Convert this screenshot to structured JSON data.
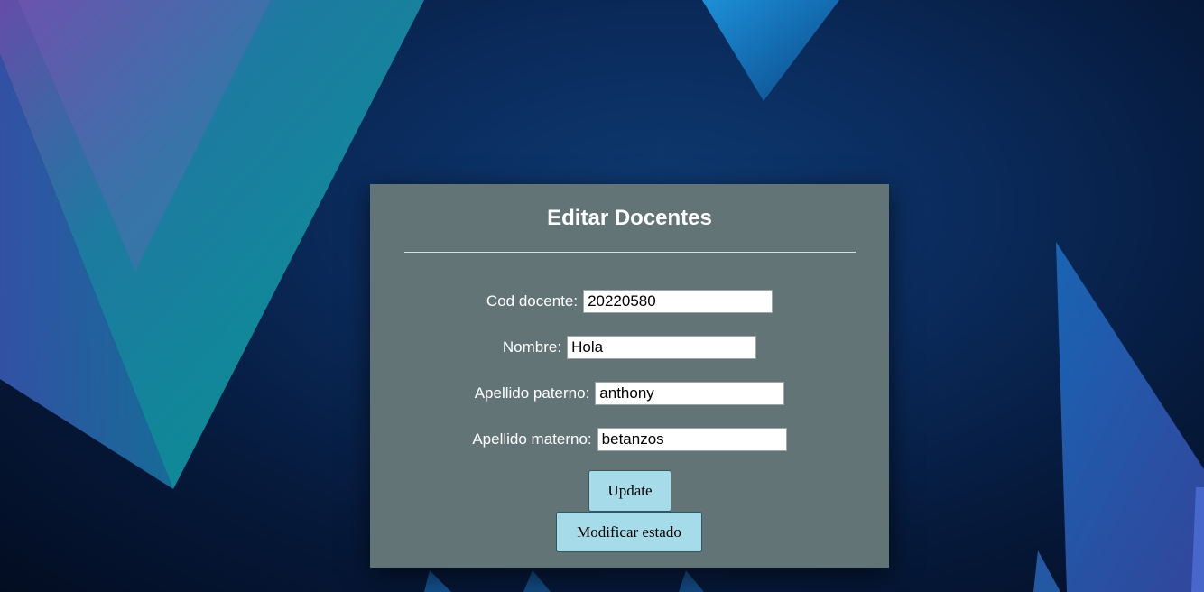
{
  "form": {
    "title": "Editar Docentes",
    "fields": [
      {
        "label": "Cod docente:",
        "value": "20220580"
      },
      {
        "label": "Nombre:",
        "value": "Hola"
      },
      {
        "label": "Apellido paterno:",
        "value": "anthony"
      },
      {
        "label": "Apellido materno:",
        "value": "betanzos"
      }
    ],
    "update_label": "Update",
    "modify_state_label": "Modificar estado"
  },
  "colors": {
    "panel": "#637477",
    "button": "#a6dcea",
    "background": "#0a2a5a"
  }
}
